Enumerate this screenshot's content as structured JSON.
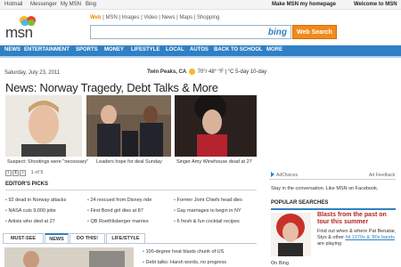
{
  "topbar": {
    "links": [
      "Hotmail",
      "Messenger",
      "My MSN",
      "Bing"
    ],
    "make_homepage": "Make MSN my homepage",
    "welcome": "Welcome to MSN"
  },
  "search": {
    "scopes": [
      "Web",
      "MSN",
      "Images",
      "Video",
      "News",
      "Maps",
      "Shopping"
    ],
    "active_scope": "Web",
    "bing_mark": "bing",
    "button_label": "Web Search"
  },
  "logo": {
    "text": "msn"
  },
  "nav": {
    "items": [
      "NEWS",
      "ENTERTAINMENT",
      "SPORTS",
      "MONEY",
      "LIFESTYLE",
      "LOCAL",
      "AUTOS",
      "BACK TO SCHOOL",
      "MORE"
    ]
  },
  "dateline": {
    "date": "Saturday, July 23, 2011"
  },
  "weather": {
    "location": "Twin Peaks, CA",
    "temp": "70°/ 48°",
    "unit_f": "°F",
    "unit_c": "°C",
    "separator": "|",
    "forecast": "5-day",
    "tenday": "10-day"
  },
  "headline": {
    "text": "News: Norway Tragedy, Debt Talks & More"
  },
  "photos": [
    {
      "caption": "Suspect: Shootings were \"necessary\""
    },
    {
      "caption": "Leaders hope for deal Sunday"
    },
    {
      "caption": "Singer Amy Winehouse dead at 27"
    }
  ],
  "pager": {
    "count": "1 of 5"
  },
  "editors_picks": {
    "title": "EDITOR'S PICKS",
    "col1": [
      "92 dead in Norway attacks",
      "NASA cuts 9,000 jobs",
      "Artists who died at 27"
    ],
    "col2": [
      "24 rescued from Disney ride",
      "First Bond girl dies at 87",
      "QB Roethlisberger marries"
    ],
    "col3": [
      "Former Joint Chiefs head dies",
      "Gay marriages to begin in NY",
      "6 fresh & fun cocktail recipes"
    ]
  },
  "tabs": {
    "items": [
      "MUST-SEE",
      "NEWS",
      "DO THIS!",
      "LIFE/STYLE"
    ],
    "active": "NEWS"
  },
  "news_list": [
    "100-degree heat blasts chunk of US",
    "Debt talks: Harsh words, no progress"
  ],
  "right_column": {
    "adchoices": "AdChoices",
    "ad_feedback": "Ad Feedback",
    "facebook_text": "Stay in the conversation. Like MSN on Facebook.",
    "popular_title": "POPULAR SEARCHES",
    "popular_headline": "Blasts from the past on tour this summer",
    "popular_body": "Find out when & where Pat Benatar, Styx & other",
    "popular_link": "hit 1970s & '80s bands",
    "popular_tail": "are playing",
    "on_bing": "On Bing"
  },
  "colors": {
    "nav_blue": "#2f80c5",
    "search_orange": "#f08a1c",
    "popular_red": "#b3261e"
  }
}
